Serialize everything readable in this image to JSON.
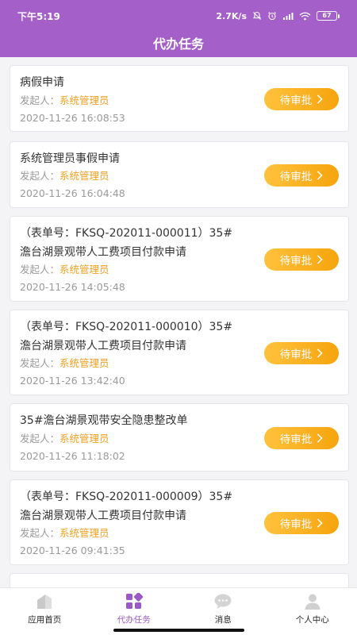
{
  "status_bar": {
    "time": "下午5:19",
    "speed": "2.7K/s",
    "battery": "67"
  },
  "header": {
    "title": "代办任务"
  },
  "approve_label": "待审批",
  "initiator_label": "发起人：",
  "tasks": [
    {
      "title_lines": [
        "病假申请"
      ],
      "initiator": "系统管理员",
      "time": "2020-11-26 16:08:53"
    },
    {
      "title_lines": [
        "系统管理员事假申请"
      ],
      "initiator": "系统管理员",
      "time": "2020-11-26 16:04:48"
    },
    {
      "title_lines": [
        "（表单号：FKSQ-202011-000011）35#",
        "澹台湖景观带人工费项目付款申请"
      ],
      "initiator": "系统管理员",
      "time": "2020-11-26 14:05:48"
    },
    {
      "title_lines": [
        "（表单号：FKSQ-202011-000010）35#",
        "澹台湖景观带人工费项目付款申请"
      ],
      "initiator": "系统管理员",
      "time": "2020-11-26 13:42:40"
    },
    {
      "title_lines": [
        "35#澹台湖景观带安全隐患整改单"
      ],
      "initiator": "系统管理员",
      "time": "2020-11-26 11:18:02"
    },
    {
      "title_lines": [
        "（表单号：FKSQ-202011-000009）35#",
        "澹台湖景观带人工费项目付款申请"
      ],
      "initiator": "系统管理员",
      "time": "2020-11-26 09:41:35"
    }
  ],
  "tabbar": {
    "home": "应用首页",
    "tasks": "代办任务",
    "messages": "消息",
    "profile": "个人中心"
  }
}
